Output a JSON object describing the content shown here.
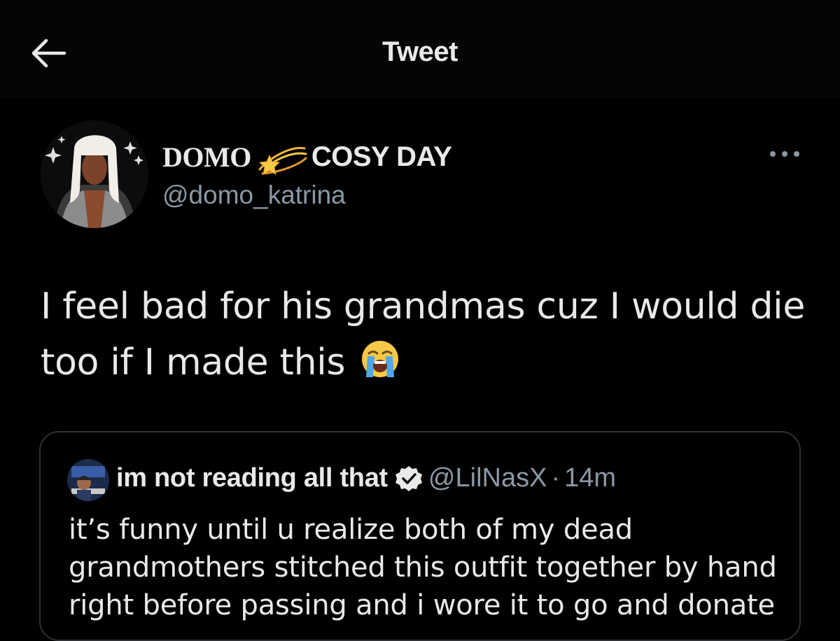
{
  "header": {
    "title": "Tweet",
    "back_icon": "arrow-left-icon"
  },
  "tweet": {
    "author": {
      "display_name_part1": "DOMO",
      "display_name_emoji": "dizzy-emoji",
      "display_name_part2": "COSY DAY",
      "handle": "@domo_katrina"
    },
    "more_icon": "more-horizontal-icon",
    "text": "I feel bad for his grandmas cuz I would die too if I made this",
    "text_emoji": "loudly-crying-face-emoji"
  },
  "quoted_tweet": {
    "author": {
      "display_name": "im not reading all that",
      "verified": true,
      "handle": "@LilNasX",
      "separator": "·",
      "time": "14m"
    },
    "text": "it’s funny until u realize both of my dead grandmothers stitched this outfit together by hand right before passing and i wore it to go and donate"
  },
  "colors": {
    "background": "#000000",
    "text_primary": "#e7e9ea",
    "text_secondary": "#8b98a5",
    "border": "#2f3336",
    "verified_badge": "#e7e9ea"
  }
}
